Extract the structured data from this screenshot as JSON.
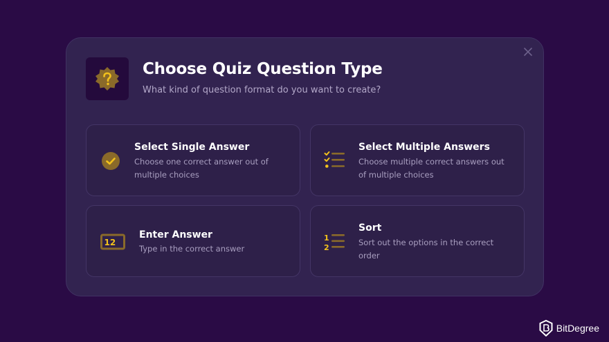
{
  "modal": {
    "title": "Choose Quiz Question Type",
    "subtitle": "What kind of question format do you want to create?",
    "header_icon": "question-badge-icon",
    "close_icon": "close-icon"
  },
  "options": [
    {
      "title": "Select Single Answer",
      "description": "Choose one correct answer out of multiple choices",
      "icon": "check-circle-icon"
    },
    {
      "title": "Select Multiple Answers",
      "description": "Choose multiple correct answers out of multiple choices",
      "icon": "checklist-icon"
    },
    {
      "title": "Enter Answer",
      "description": "Type in the correct answer",
      "icon": "number-input-icon"
    },
    {
      "title": "Sort",
      "description": "Sort out the options in the correct order",
      "icon": "ordered-list-icon"
    }
  ],
  "branding": {
    "name": "BitDegree",
    "icon": "bitdegree-logo-icon"
  },
  "colors": {
    "background": "#2a0b45",
    "modal": "#322350",
    "card": "#2e2049",
    "accent": "#e8b722",
    "icon_brown": "#8a6a2a"
  }
}
